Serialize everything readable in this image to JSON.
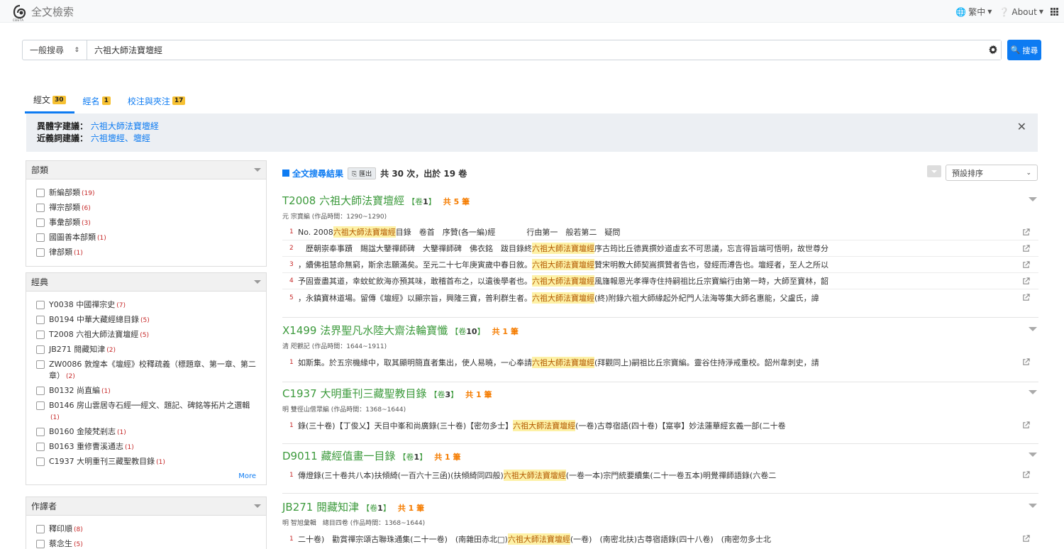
{
  "header": {
    "app_title": "全文檢索",
    "logo_text": "CBETA",
    "language": "繁中",
    "about": "About"
  },
  "search": {
    "type_label": "一般搜尋",
    "query": "六祖大師法寶壇經",
    "button_label": "搜尋"
  },
  "tabs": [
    {
      "label": "經文",
      "count": "30"
    },
    {
      "label": "經名",
      "count": "1"
    },
    {
      "label": "校注與夾注",
      "count": "17"
    }
  ],
  "suggestions": {
    "variant_label": "異體字建議",
    "variant_value": "六祖大師法寶壇経",
    "synonym_label": "近義詞建議",
    "synonym_values": [
      "六祖壇經",
      "壇經"
    ],
    "synonym_sep": "、"
  },
  "facets": {
    "category": {
      "title": "部類",
      "items": [
        {
          "label": "新編部類",
          "count": "(19)"
        },
        {
          "label": "禪宗部類",
          "count": "(6)"
        },
        {
          "label": "事彙部類",
          "count": "(3)"
        },
        {
          "label": "國圖善本部類",
          "count": "(1)"
        },
        {
          "label": "律部類",
          "count": "(1)"
        }
      ]
    },
    "canon": {
      "title": "經典",
      "items": [
        {
          "label": "Y0038 中國禪宗史",
          "count": "(7)"
        },
        {
          "label": "B0194 中華大藏經總目錄",
          "count": "(5)"
        },
        {
          "label": "T2008 六祖大師法寶壇經",
          "count": "(5)"
        },
        {
          "label": "JB271 閱藏知津",
          "count": "(2)"
        },
        {
          "label": "ZW0086 敦煌本《壇經》校釋疏義（標題章、第一章、第二章）",
          "count": "(2)"
        },
        {
          "label": "B0132 尚直編",
          "count": "(1)"
        },
        {
          "label": "B0146 房山雲居寺石經──經文、題記、碑銘等拓片之選輯",
          "count": "(1)"
        },
        {
          "label": "B0160 金陵梵剎志",
          "count": "(1)"
        },
        {
          "label": "B0163 重修曹溪通志",
          "count": "(1)"
        },
        {
          "label": "C1937 大明重刊三藏聖教目錄",
          "count": "(1)"
        }
      ],
      "more": "More"
    },
    "author": {
      "title": "作譯者",
      "items": [
        {
          "label": "釋印順",
          "count": "(8)"
        },
        {
          "label": "蔡念生",
          "count": "(5)"
        }
      ]
    }
  },
  "results": {
    "label": "全文搜尋結果",
    "export": "匯出",
    "summary_prefix": "共",
    "times": "30",
    "summary_mid": "次，出於",
    "juans": "19",
    "summary_suffix": "卷",
    "sort": "預設排序",
    "works": [
      {
        "id": "T2008",
        "title": "六祖大師法寶壇經",
        "juan": "1",
        "total": "5",
        "meta": "元 宗寶編 (作品時間：1290~1290)",
        "hits": [
          {
            "n": "1",
            "before": "No. 2008",
            "hl": "六祖大師法寶壇經",
            "after": "目錄　卷首　序贊(各一編)經　　　　行由第一　般若第二　疑問"
          },
          {
            "n": "2",
            "before": "　歷朝崇奉事蹟　賜諡大鑒禪師碑　大鑒禪師碑　佛衣銘　跋目錄終",
            "hl": "六祖大師法寶壇經",
            "after": "序古筠比丘德異撰妙道虛玄不可思議，忘言得旨端可悟明，故世尊分"
          },
          {
            "n": "3",
            "before": "，續佛祖慧命無窮，斯余志願滿矣。至元二十七年庚寅歲中春日敘。",
            "hl": "六祖大師法寶壇經",
            "after": "贊宋明教大師契嵩撰贊者告也，發經而溥告也。壇經者，至人之所以"
          },
          {
            "n": "4",
            "before": "予固壹盡其道，幸蚊虻飲海亦預其味，敢稽首布之，以遺後學者也。",
            "hl": "六祖大師法寶壇經",
            "after": "風旛報恩光孝禪寺住持嗣祖比丘宗寶編行由第一時，大師至寶林，韶"
          },
          {
            "n": "5",
            "before": "，永鎮寶林道場。留傳《壇經》以顯宗旨，興隆三寶，普利群生者。",
            "hl": "六祖大師法寶壇經",
            "after": "(終)附錄六祖大師緣起外紀門人法海等集大師名惠能，父盧氏，諱"
          }
        ]
      },
      {
        "id": "X1499",
        "title": "法界聖凡水陸大齋法輪寶懺",
        "juan": "10",
        "total": "1",
        "meta": "清 咫觀記 (作品時間：1644~1911)",
        "hits": [
          {
            "n": "1",
            "before": "如斯集。於五宗機緣中，取其顯明簡直者集出，使人易曉，一心奉請",
            "hl": "六祖大師法寶壇經",
            "after": "(拜觀同上)嗣祖比丘宗寶編。靈谷住持淨戒重校。韶州韋刺史，請"
          }
        ]
      },
      {
        "id": "C1937",
        "title": "大明重刊三藏聖教目錄",
        "juan": "3",
        "total": "1",
        "meta": "明 雙徑山僧眾編 (作品時間：1368~1644)",
        "hits": [
          {
            "n": "1",
            "before": "錄(三十卷)【丁俊乂】天目中峯和尚廣錄(三十卷)【密勿多士】",
            "hl": "六祖大師法寶壇經",
            "after": "(一卷)古尊宿語(四十卷)【寔寧】妙法蓮華經玄義一部(二十卷"
          }
        ]
      },
      {
        "id": "D9011",
        "title": "藏經值畫一目錄",
        "juan": "1",
        "total": "1",
        "meta": "",
        "hits": [
          {
            "n": "1",
            "before": "傳燈錄(三十卷共八本)扶傾綺(一百六十三函)(扶傾綺同四般)",
            "hl": "六祖大師法寶壇經",
            "after": "(一卷一本)宗門統要續集(二十一卷五本)明覺禪師語錄(六卷二"
          }
        ]
      },
      {
        "id": "JB271",
        "title": "閱藏知津",
        "juan": "1",
        "total": "1",
        "meta": "明 智旭彙輯　總目四卷 (作品時間：1368~1644)",
        "hits": [
          {
            "n": "1",
            "before": "二十卷)　勸賞禪宗頌古聯珠通集(二十一卷)　(南雜田赤北□)",
            "hl": "六祖大師法寶壇經",
            "after": "(一卷)　(南密北扶)古尊宿語錄(四十八卷)　(南密勿多士北"
          }
        ]
      }
    ]
  }
}
